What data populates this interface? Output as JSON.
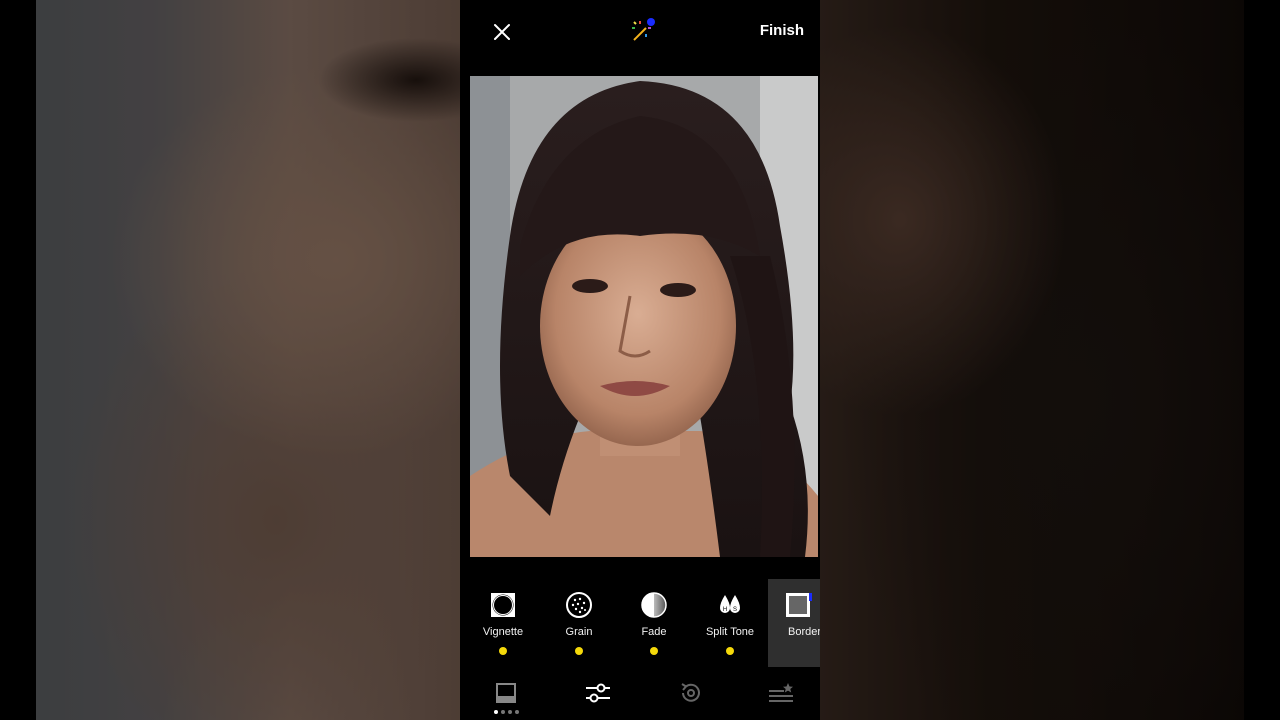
{
  "topbar": {
    "finish_label": "Finish",
    "close_icon": "close-icon",
    "magic_icon": "magic-wand-icon"
  },
  "photo": {
    "description_icon": "portrait-photo"
  },
  "tools": [
    {
      "label": "Vignette",
      "icon": "vignette-icon",
      "active_dot": true,
      "selected": false
    },
    {
      "label": "Grain",
      "icon": "grain-icon",
      "active_dot": true,
      "selected": false
    },
    {
      "label": "Fade",
      "icon": "fade-icon",
      "active_dot": true,
      "selected": false
    },
    {
      "label": "Split Tone",
      "icon": "split-tone-icon",
      "active_dot": true,
      "selected": false
    },
    {
      "label": "Borders",
      "icon": "borders-icon",
      "active_dot": false,
      "selected": true
    }
  ],
  "bottom_nav": [
    {
      "icon": "presets-icon"
    },
    {
      "icon": "adjust-sliders-icon"
    },
    {
      "icon": "history-icon"
    },
    {
      "icon": "recipes-icon"
    }
  ],
  "colors": {
    "accent_dot": "#f5d90a",
    "magic_dot": "#1a2cff",
    "background": "#000000"
  }
}
